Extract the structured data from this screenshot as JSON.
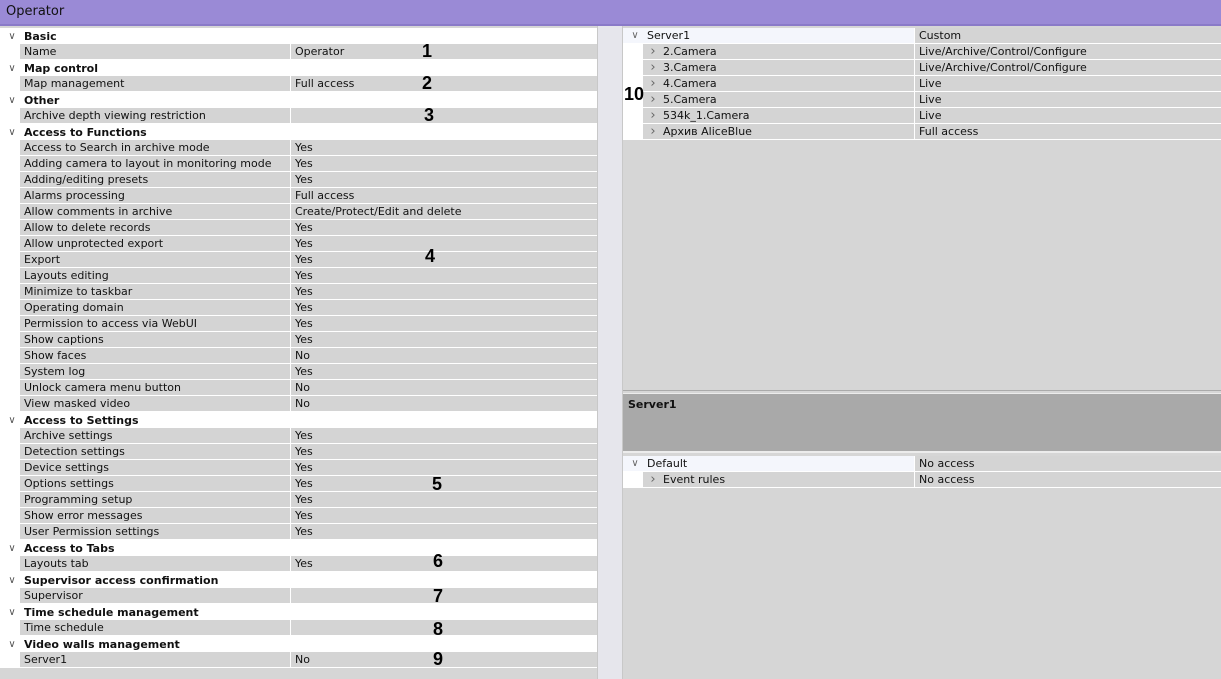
{
  "window": {
    "title": "Operator"
  },
  "sections": [
    {
      "title": "Basic",
      "items": [
        {
          "label": "Name",
          "value": "Operator"
        }
      ]
    },
    {
      "title": "Map control",
      "items": [
        {
          "label": "Map management",
          "value": "Full access"
        }
      ]
    },
    {
      "title": "Other",
      "items": [
        {
          "label": "Archive depth viewing restriction",
          "value": ""
        }
      ]
    },
    {
      "title": "Access to Functions",
      "items": [
        {
          "label": "Access to Search in archive mode",
          "value": "Yes"
        },
        {
          "label": "Adding camera to layout in monitoring mode",
          "value": "Yes"
        },
        {
          "label": "Adding/editing presets",
          "value": "Yes"
        },
        {
          "label": "Alarms processing",
          "value": "Full access"
        },
        {
          "label": "Allow comments in archive",
          "value": "Create/Protect/Edit and delete"
        },
        {
          "label": "Allow to delete records",
          "value": "Yes"
        },
        {
          "label": "Allow unprotected export",
          "value": "Yes"
        },
        {
          "label": "Export",
          "value": "Yes"
        },
        {
          "label": "Layouts editing",
          "value": "Yes"
        },
        {
          "label": "Minimize to taskbar",
          "value": "Yes"
        },
        {
          "label": "Operating domain",
          "value": "Yes"
        },
        {
          "label": "Permission to access via WebUI",
          "value": "Yes"
        },
        {
          "label": "Show captions",
          "value": "Yes"
        },
        {
          "label": "Show faces",
          "value": "No"
        },
        {
          "label": "System log",
          "value": "Yes"
        },
        {
          "label": "Unlock camera menu button",
          "value": "No"
        },
        {
          "label": "View masked video",
          "value": "No"
        }
      ]
    },
    {
      "title": "Access to Settings",
      "items": [
        {
          "label": "Archive settings",
          "value": "Yes"
        },
        {
          "label": "Detection settings",
          "value": "Yes"
        },
        {
          "label": "Device settings",
          "value": "Yes"
        },
        {
          "label": "Options settings",
          "value": "Yes"
        },
        {
          "label": "Programming setup",
          "value": "Yes"
        },
        {
          "label": "Show error messages",
          "value": "Yes"
        },
        {
          "label": "User Permission settings",
          "value": "Yes"
        }
      ]
    },
    {
      "title": "Access to Tabs",
      "items": [
        {
          "label": "Layouts tab",
          "value": "Yes"
        }
      ]
    },
    {
      "title": "Supervisor access confirmation",
      "items": [
        {
          "label": "Supervisor",
          "value": ""
        }
      ]
    },
    {
      "title": "Time schedule management",
      "items": [
        {
          "label": "Time schedule",
          "value": ""
        }
      ]
    },
    {
      "title": "Video walls management",
      "items": [
        {
          "label": "Server1",
          "value": "No"
        }
      ]
    }
  ],
  "annotations": [
    "1",
    "2",
    "3",
    "4",
    "5",
    "6",
    "7",
    "8",
    "9",
    "10"
  ],
  "devices": {
    "root": {
      "name": "Server1",
      "value": "Custom"
    },
    "children": [
      {
        "name": "2.Camera",
        "value": "Live/Archive/Control/Configure"
      },
      {
        "name": "3.Camera",
        "value": "Live/Archive/Control/Configure"
      },
      {
        "name": "4.Camera",
        "value": "Live"
      },
      {
        "name": "5.Camera",
        "value": "Live"
      },
      {
        "name": "534k_1.Camera",
        "value": "Live"
      },
      {
        "name": "Архив AliceBlue",
        "value": "Full access"
      }
    ]
  },
  "detail": {
    "header": "Server1",
    "root": {
      "name": "Default",
      "value": "No access"
    },
    "children": [
      {
        "name": "Event rules",
        "value": "No access"
      }
    ]
  }
}
